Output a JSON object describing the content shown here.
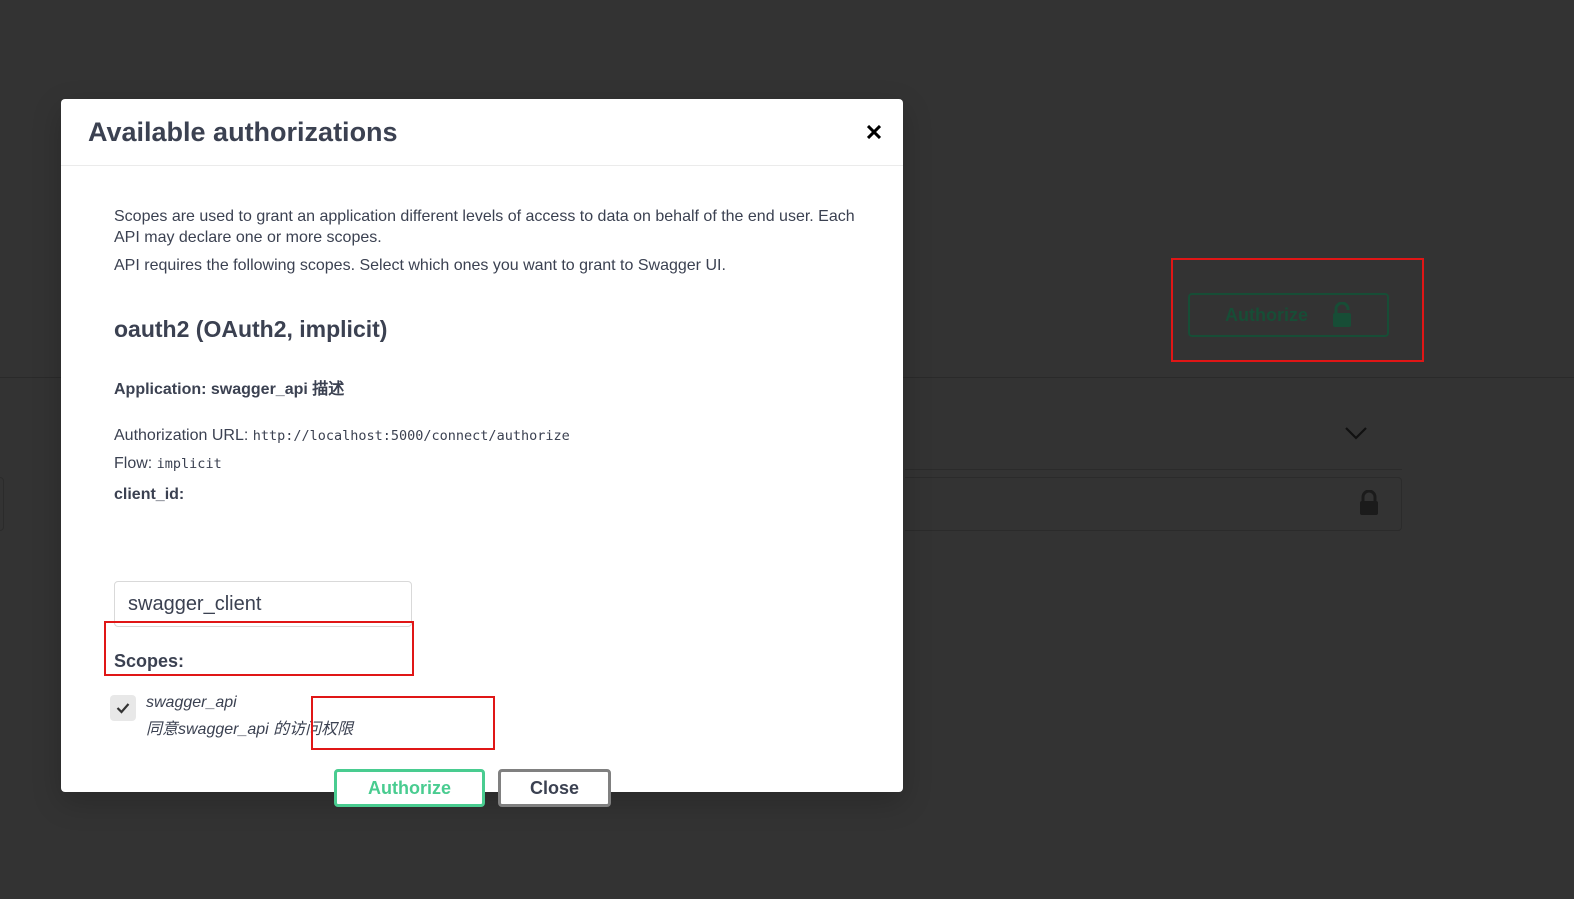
{
  "background": {
    "authorize_button_label": "Authorize"
  },
  "modal": {
    "title": "Available authorizations",
    "description_1": "Scopes are used to grant an application different levels of access to data on behalf of the end user. Each API may declare one or more scopes.",
    "description_2": "API requires the following scopes. Select which ones you want to grant to Swagger UI.",
    "scheme_title": "oauth2 (OAuth2, implicit)",
    "application": "Application: swagger_api 描述",
    "authorization_url_label": "Authorization URL: ",
    "authorization_url": "http://localhost:5000/connect/authorize",
    "flow_label": "Flow: ",
    "flow": "implicit",
    "client_id_label": "client_id:",
    "client_id_value": "swagger_client",
    "scopes_label": "Scopes:",
    "scopes": [
      {
        "name": "swagger_api",
        "description": "同意swagger_api 的访问权限",
        "checked": true
      }
    ],
    "authorize_label": "Authorize",
    "close_label": "Close"
  },
  "colors": {
    "overlay": "#333333",
    "authorize_green": "#49cc90",
    "highlight_red": "#e01616",
    "text": "#3b4151"
  },
  "icons": {
    "close": "close-icon",
    "lock": "lock-icon",
    "check": "check-icon",
    "chevron": "chevron-down-icon"
  }
}
